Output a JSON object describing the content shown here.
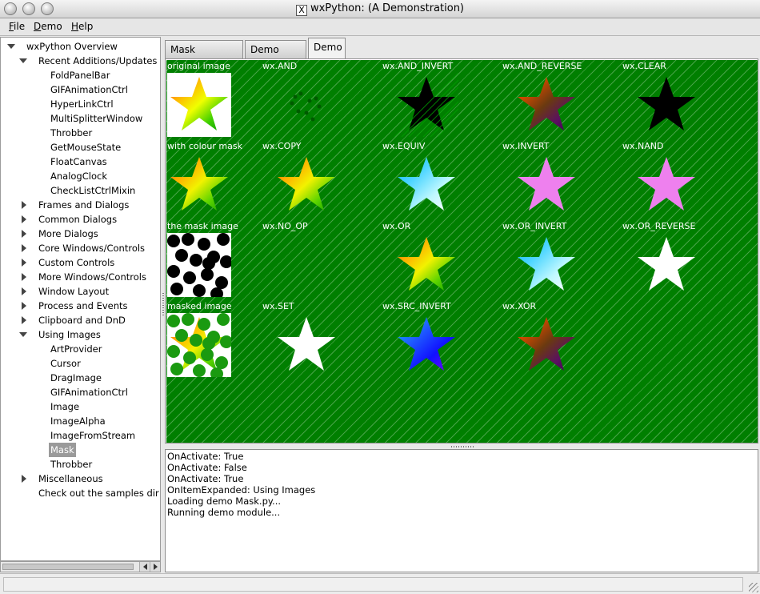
{
  "window": {
    "title": "wxPython: (A Demonstration)"
  },
  "menu": [
    {
      "label": "File",
      "accel": "F",
      "rest": "ile"
    },
    {
      "label": "Demo",
      "accel": "D",
      "rest": "emo"
    },
    {
      "label": "Help",
      "accel": "H",
      "rest": "elp"
    }
  ],
  "tree": [
    {
      "label": "wxPython Overview",
      "level": 0,
      "state": "open"
    },
    {
      "label": "Recent Additions/Updates",
      "level": 1,
      "state": "open"
    },
    {
      "label": "FoldPanelBar",
      "level": 2,
      "state": "leaf"
    },
    {
      "label": "GIFAnimationCtrl",
      "level": 2,
      "state": "leaf"
    },
    {
      "label": "HyperLinkCtrl",
      "level": 2,
      "state": "leaf"
    },
    {
      "label": "MultiSplitterWindow",
      "level": 2,
      "state": "leaf"
    },
    {
      "label": "Throbber",
      "level": 2,
      "state": "leaf"
    },
    {
      "label": "GetMouseState",
      "level": 2,
      "state": "leaf"
    },
    {
      "label": "FloatCanvas",
      "level": 2,
      "state": "leaf"
    },
    {
      "label": "AnalogClock",
      "level": 2,
      "state": "leaf"
    },
    {
      "label": "CheckListCtrlMixin",
      "level": 2,
      "state": "leaf"
    },
    {
      "label": "Frames and Dialogs",
      "level": 1,
      "state": "closed"
    },
    {
      "label": "Common Dialogs",
      "level": 1,
      "state": "closed"
    },
    {
      "label": "More Dialogs",
      "level": 1,
      "state": "closed"
    },
    {
      "label": "Core Windows/Controls",
      "level": 1,
      "state": "closed"
    },
    {
      "label": "Custom Controls",
      "level": 1,
      "state": "closed"
    },
    {
      "label": "More Windows/Controls",
      "level": 1,
      "state": "closed"
    },
    {
      "label": "Window Layout",
      "level": 1,
      "state": "closed"
    },
    {
      "label": "Process and Events",
      "level": 1,
      "state": "closed"
    },
    {
      "label": "Clipboard and DnD",
      "level": 1,
      "state": "closed"
    },
    {
      "label": "Using Images",
      "level": 1,
      "state": "open"
    },
    {
      "label": "ArtProvider",
      "level": 2,
      "state": "leaf"
    },
    {
      "label": "Cursor",
      "level": 2,
      "state": "leaf"
    },
    {
      "label": "DragImage",
      "level": 2,
      "state": "leaf"
    },
    {
      "label": "GIFAnimationCtrl",
      "level": 2,
      "state": "leaf"
    },
    {
      "label": "Image",
      "level": 2,
      "state": "leaf"
    },
    {
      "label": "ImageAlpha",
      "level": 2,
      "state": "leaf"
    },
    {
      "label": "ImageFromStream",
      "level": 2,
      "state": "leaf"
    },
    {
      "label": "Mask",
      "level": 2,
      "state": "leaf",
      "selected": true
    },
    {
      "label": "Throbber",
      "level": 2,
      "state": "leaf"
    },
    {
      "label": "Miscellaneous",
      "level": 1,
      "state": "closed"
    },
    {
      "label": "Check out the samples dir t",
      "level": 1,
      "state": "leaf"
    }
  ],
  "tabs": [
    {
      "label": "Mask Overview",
      "active": false
    },
    {
      "label": "Demo Code",
      "active": false
    },
    {
      "label": "Demo",
      "active": true
    }
  ],
  "grid": [
    {
      "label": "original image",
      "kind": "original"
    },
    {
      "label": "wx.AND",
      "kind": "faint"
    },
    {
      "label": "wx.AND_INVERT",
      "kind": "black-star-stripes"
    },
    {
      "label": "wx.AND_REVERSE",
      "kind": "dark-rainbow"
    },
    {
      "label": "wx.CLEAR",
      "kind": "black-star"
    },
    {
      "label": "with colour mask",
      "kind": "rainbow"
    },
    {
      "label": "wx.COPY",
      "kind": "rainbow"
    },
    {
      "label": "wx.EQUIV",
      "kind": "cyan-star"
    },
    {
      "label": "wx.INVERT",
      "kind": "violet-star"
    },
    {
      "label": "wx.NAND",
      "kind": "violet-star"
    },
    {
      "label": "the mask image",
      "kind": "mask"
    },
    {
      "label": "wx.NO_OP",
      "kind": "none"
    },
    {
      "label": "wx.OR",
      "kind": "rainbow"
    },
    {
      "label": "wx.OR_INVERT",
      "kind": "cyan-star"
    },
    {
      "label": "wx.OR_REVERSE",
      "kind": "white-star"
    },
    {
      "label": "masked image",
      "kind": "masked"
    },
    {
      "label": "wx.SET",
      "kind": "white-star"
    },
    {
      "label": "wx.SRC_INVERT",
      "kind": "blue-star"
    },
    {
      "label": "wx.XOR",
      "kind": "dark-rainbow"
    }
  ],
  "colors": {
    "canvas_bg": "#007f00",
    "selection": "#9a9a9a"
  },
  "log": [
    "OnActivate: True",
    "OnActivate: False",
    "OnActivate: True",
    "OnItemExpanded: Using Images",
    "Loading demo Mask.py...",
    "Running demo module..."
  ]
}
